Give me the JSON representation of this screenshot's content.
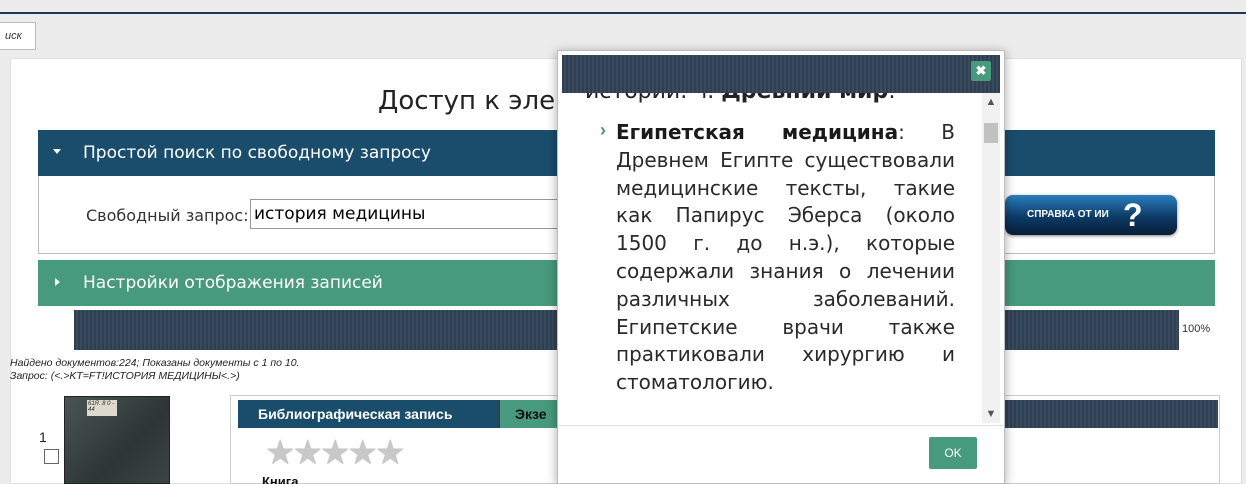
{
  "tab": {
    "label": "иск"
  },
  "main": {
    "title": "Доступ к эле"
  },
  "simple_search": {
    "header": "Простой поиск по свободному запросу",
    "query_label": "Свободный запрос:",
    "query_value": "история медицины",
    "help_button": "СПРАВКА ОТ ИИ"
  },
  "display_settings": {
    "header": "Настройки отображения записей"
  },
  "progress": {
    "value_percent": 100,
    "label": "100%"
  },
  "results": {
    "found_line": "Найдено документов:224; Показаны документы с 1 по 10.",
    "query_line": "Запрос:  (<.>KT=FT!ИСТОРИЯ МЕДИЦИНЫ<.>)"
  },
  "record": {
    "number": "1",
    "thumb_label": "61Я. 8\n0 - 44",
    "tab_biblio": "Библиографическая запись",
    "tab_copies": "Экзе",
    "rating_stars": 0,
    "rating_max": 5,
    "kind": "Книга"
  },
  "modal": {
    "cut_text_prefix": "истории. ч. ",
    "cut_text_bold": "Древний мир",
    "cut_text_suffix": ":",
    "para_bold": "Египетская медицина",
    "para_text": ": В Древнем Египте существовали медицинские тексты, такие как Папирус Эберса (около 1500 г. до н.э.), которые содержали знания о лечении различных заболеваний. Египетские врачи также практиковали хирургию и стоматологию.",
    "close_glyph": "✖",
    "ok_label": "OK"
  }
}
